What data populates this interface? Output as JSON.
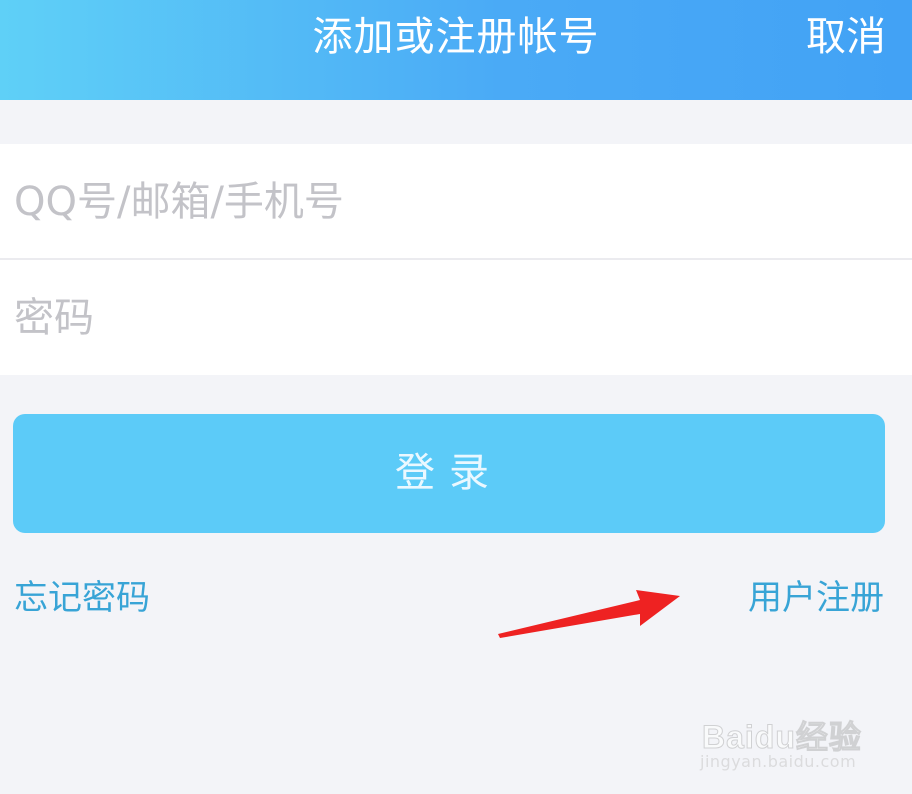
{
  "header": {
    "title": "添加或注册帐号",
    "cancel_label": "取消"
  },
  "form": {
    "account_placeholder": "QQ号/邮箱/手机号",
    "password_placeholder": "密码"
  },
  "login_button": {
    "label": "登录"
  },
  "links": {
    "forgot_password": "忘记密码",
    "register": "用户注册"
  },
  "annotation": {
    "arrow_color": "#ee2222",
    "icon": "red-arrow-icon"
  },
  "watermark": {
    "logo_text": "Baidu经验",
    "url_text": "jingyan.baidu.com"
  },
  "colors": {
    "header_gradient_start": "#5fd0f7",
    "header_gradient_end": "#42a2f5",
    "login_button": "#5ccbf8",
    "link": "#38a4d6",
    "background": "#f3f4f8"
  }
}
